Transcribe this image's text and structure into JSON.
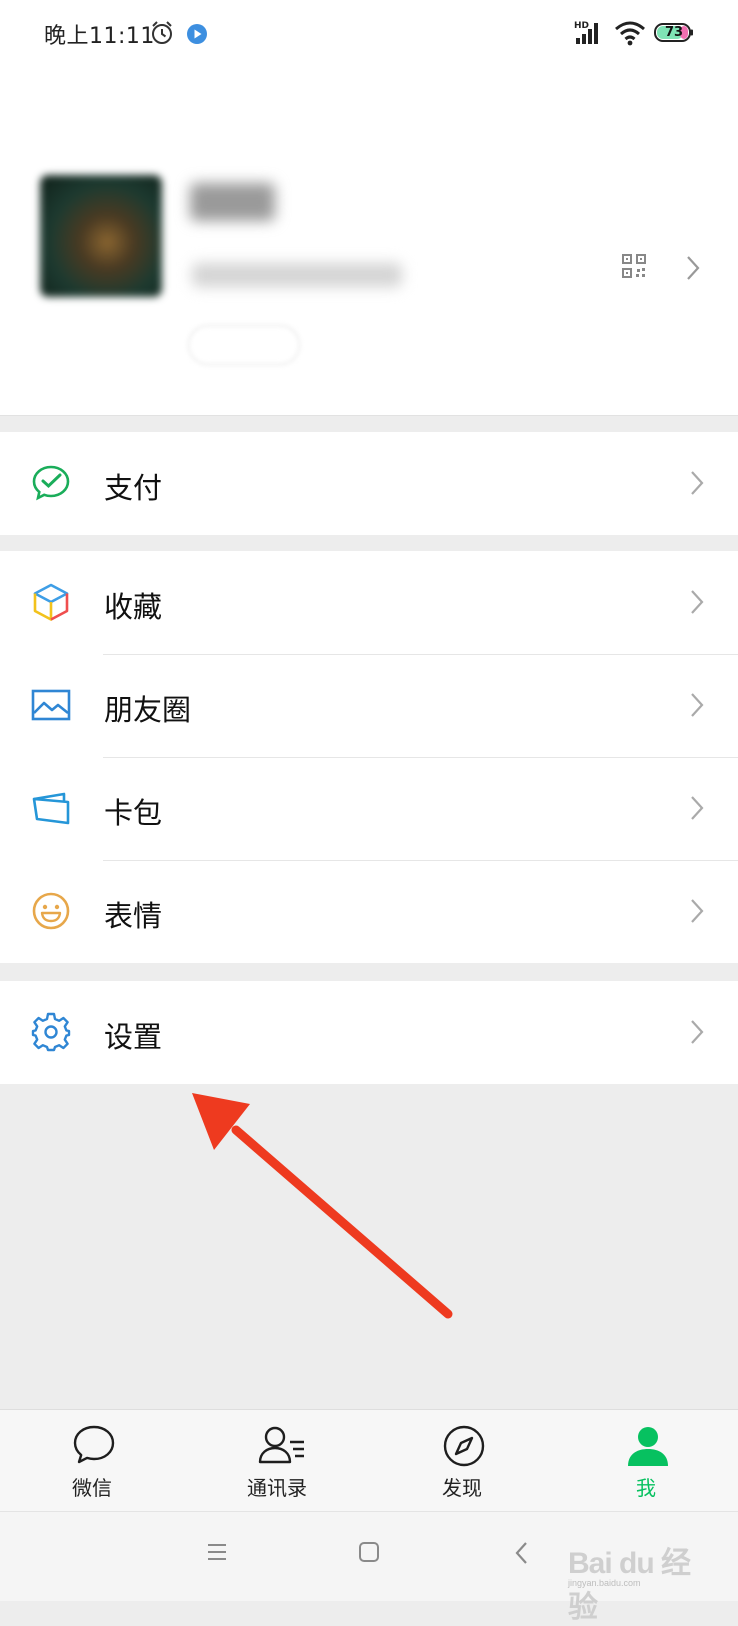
{
  "status_bar": {
    "time": "晚上11:11",
    "network_label": "HD",
    "battery": "73"
  },
  "profile": {
    "qr_icon": "qr-code-icon",
    "chevron_icon": "chevron-right-icon"
  },
  "menu": {
    "pay": {
      "label": "支付",
      "icon": "wechat-pay-icon"
    },
    "favorites": {
      "label": "收藏",
      "icon": "cube-icon"
    },
    "moments": {
      "label": "朋友圈",
      "icon": "picture-icon"
    },
    "cards": {
      "label": "卡包",
      "icon": "card-holder-icon"
    },
    "stickers": {
      "label": "表情",
      "icon": "smiley-icon"
    },
    "settings": {
      "label": "设置",
      "icon": "gear-icon"
    }
  },
  "tabs": [
    {
      "label": "微信",
      "icon": "chat-bubble-icon",
      "active": false
    },
    {
      "label": "通讯录",
      "icon": "contacts-icon",
      "active": false
    },
    {
      "label": "发现",
      "icon": "compass-icon",
      "active": false
    },
    {
      "label": "我",
      "icon": "person-icon",
      "active": true
    }
  ],
  "watermark": {
    "main": "Bai du 经验",
    "sub": "jingyan.baidu.com"
  },
  "colors": {
    "accent": "#07c160",
    "annotation_arrow": "#ee3a1f",
    "settings_icon": "#2f86d4",
    "stickers_icon": "#e7a74a"
  }
}
